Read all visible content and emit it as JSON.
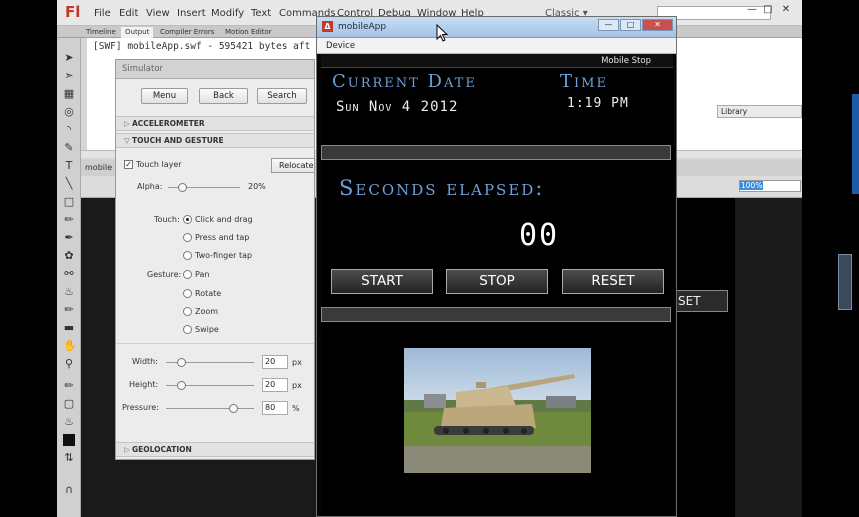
{
  "ide": {
    "logo": "Fl",
    "menu": [
      "File",
      "Edit",
      "View",
      "Insert",
      "Modify",
      "Text",
      "Commands",
      "Control",
      "Debug",
      "Window",
      "Help"
    ],
    "workspace": "Classic ▾",
    "panel_tabs": [
      "Timeline",
      "Output",
      "Compiler Errors",
      "Motion Editor"
    ],
    "output_text": "[SWF] mobileApp.swf - 595421 bytes aft",
    "library_tab": "Library",
    "document_tab": "mobile",
    "zoom_value": "100%",
    "background_reset_label": "SET"
  },
  "simulator": {
    "title": "Simulator",
    "buttons": [
      "Menu",
      "Back",
      "Search"
    ],
    "sections": {
      "accelerometer": "ACCELEROMETER",
      "touch": "TOUCH AND GESTURE",
      "geolocation": "GEOLOCATION"
    },
    "touch_layer_label": "Touch layer",
    "relocate_label": "Relocate",
    "alpha_label": "Alpha:",
    "alpha_value": "20%",
    "alpha_level": 0.2,
    "touch_label": "Touch:",
    "touch_options": [
      "Click and drag",
      "Press and tap",
      "Two-finger tap"
    ],
    "gesture_label": "Gesture:",
    "gesture_options": [
      "Pan",
      "Rotate",
      "Zoom",
      "Swipe"
    ],
    "width_label": "Width:",
    "width_value": "20",
    "height_label": "Height:",
    "height_value": "20",
    "pressure_label": "Pressure:",
    "pressure_value": "80",
    "px_unit": "px",
    "percent_unit": "%"
  },
  "mobile_app": {
    "window_title": "mobileApp",
    "device_menu": "Device",
    "app_bar_title": "Mobile Stop",
    "current_date_label": "Current Date",
    "date_value": "Sun Nov 4 2012",
    "time_label": "Time",
    "time_value": "1:19 PM",
    "seconds_label": "Seconds elapsed:",
    "seconds_value": "00",
    "start_label": "START",
    "stop_label": "STOP",
    "reset_label": "RESET"
  },
  "colors": {
    "label_blue": "#6f9fd8",
    "title_gradient_top": "#c6dcf3",
    "app_background": "#000000"
  }
}
